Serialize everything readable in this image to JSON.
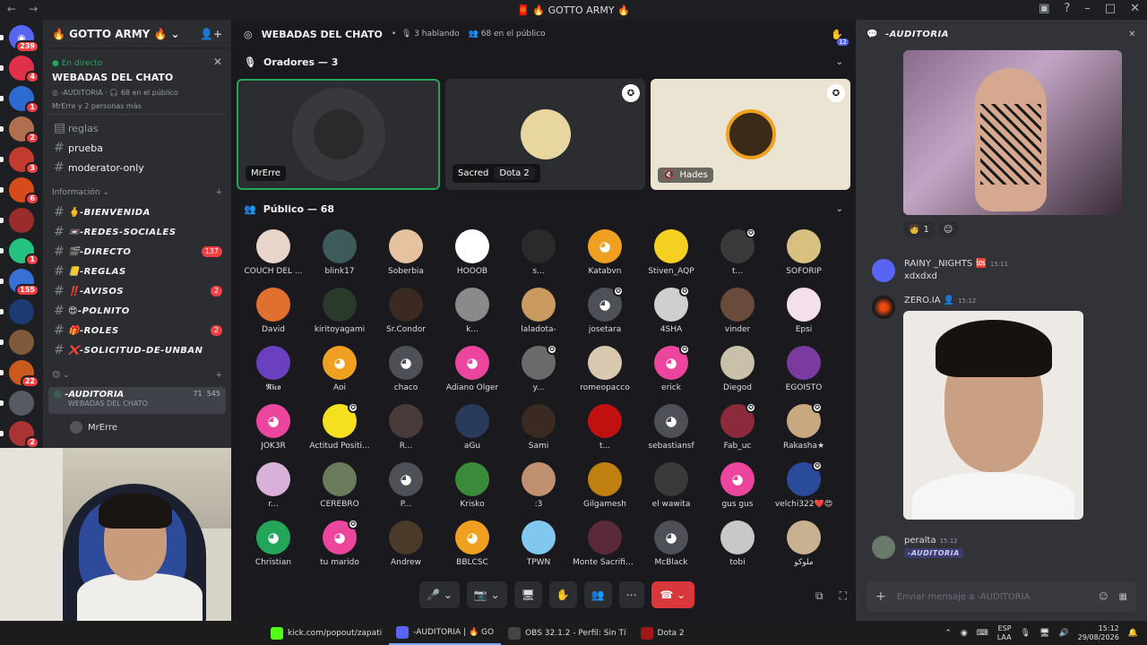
{
  "window": {
    "title": "🧧 🔥 GOTTO ARMY 🔥"
  },
  "servers": [
    {
      "name": "home",
      "color": "#5865f2",
      "badge": "239"
    },
    {
      "name": "s1",
      "color": "#e0304a",
      "badge": "4"
    },
    {
      "name": "s2",
      "color": "#2e6bd1",
      "badge": "1"
    },
    {
      "name": "s3",
      "color": "#b07050",
      "badge": "2"
    },
    {
      "name": "s4",
      "color": "#c23b2e",
      "badge": "3"
    },
    {
      "name": "s5",
      "color": "#d64b1a",
      "badge": "6"
    },
    {
      "name": "s6",
      "color": "#9a2c2c",
      "badge": ""
    },
    {
      "name": "s7",
      "color": "#26c281",
      "badge": "1"
    },
    {
      "name": "s8",
      "color": "#3b6fd8",
      "badge": "155"
    },
    {
      "name": "s9",
      "color": "#1d3b74",
      "badge": ""
    },
    {
      "name": "s10",
      "color": "#7e5a3a",
      "badge": ""
    },
    {
      "name": "s11",
      "color": "#c85a1e",
      "badge": "22"
    },
    {
      "name": "s12",
      "color": "#555a63",
      "badge": ""
    },
    {
      "name": "s13",
      "color": "#a33",
      "badge": "2"
    },
    {
      "name": "s14",
      "color": "#7a3355",
      "badge": ""
    }
  ],
  "guild": {
    "name": "🔥 GOTTO ARMY 🔥"
  },
  "live": {
    "status": "En directo",
    "title": "WEBADAS DEL CHATO",
    "host": "-AUDITORIA",
    "audience": "68 en el público",
    "others": "MrErre y 2 personas más"
  },
  "channels_top": [
    {
      "name": "reglas",
      "bold": false
    },
    {
      "name": "prueba",
      "bold": true
    },
    {
      "name": "moderator-only",
      "bold": true
    }
  ],
  "category_info": "Información",
  "channels_info": [
    {
      "name": "🫰-BIENVENIDA",
      "badge": ""
    },
    {
      "name": "📼-REDES-SOCIALES",
      "badge": ""
    },
    {
      "name": "🎬-DIRECTO",
      "badge": "137"
    },
    {
      "name": "📒-REGLAS",
      "badge": ""
    },
    {
      "name": "‼️-AVISOS",
      "badge": "2"
    },
    {
      "name": "😍-POLNITO",
      "badge": ""
    },
    {
      "name": "🎁-ROLES",
      "badge": "2"
    },
    {
      "name": "❌-SOLICITUD-DE-UNBAN",
      "badge": ""
    }
  ],
  "category_2": "😊",
  "voice_selected": {
    "name": "-AUDITORIA",
    "sub": "WEBADAS DEL CHATO",
    "count_a": "71",
    "count_b": "545",
    "user": "MrErre"
  },
  "stage": {
    "title": "WEBADAS DEL CHATO",
    "speaking": "3 hablando",
    "audience": "68 en el público",
    "hand_badge": "12",
    "speakers_label": "Oradores — 3",
    "audience_label": "Público — 68",
    "speakers": [
      {
        "name": "MrErre",
        "activity": "",
        "color": "#2a2a2a",
        "speaking": true,
        "mod": false,
        "light": false
      },
      {
        "name": "Sacred",
        "activity": "Dota 2",
        "color": "#e8d6a0",
        "speaking": false,
        "mod": true,
        "light": false
      },
      {
        "name": "Hades",
        "activity": "",
        "color": "#3a2a18",
        "speaking": false,
        "mod": true,
        "light": true
      }
    ],
    "audience_members": [
      {
        "name": "COUCH DEL ...",
        "color": "#e6d5c8",
        "mod": false,
        "disc": false
      },
      {
        "name": "blink17",
        "color": "#3d5b5a",
        "mod": false,
        "disc": false
      },
      {
        "name": "Soberbia",
        "color": "#e6c2a0",
        "mod": false,
        "disc": false
      },
      {
        "name": "HOOOB",
        "color": "#ffffff",
        "mod": false,
        "disc": false
      },
      {
        "name": "s...",
        "color": "#2a2a2a",
        "mod": false,
        "disc": false
      },
      {
        "name": "Katabvn",
        "color": "#f0a020",
        "mod": false,
        "disc": true
      },
      {
        "name": "Stiven_AQP",
        "color": "#f5d020",
        "mod": false,
        "disc": false
      },
      {
        "name": "t...",
        "color": "#3a3a3a",
        "mod": true,
        "disc": false
      },
      {
        "name": "SOFORIP",
        "color": "#d8c080",
        "mod": false,
        "disc": false
      },
      {
        "name": "David",
        "color": "#e07030",
        "mod": false,
        "disc": false
      },
      {
        "name": "kiritoyagami",
        "color": "#2a3a2a",
        "mod": false,
        "disc": false
      },
      {
        "name": "Sr.Condor",
        "color": "#3a2a22",
        "mod": false,
        "disc": false
      },
      {
        "name": "k...",
        "color": "#8a8a8a",
        "mod": false,
        "disc": false
      },
      {
        "name": "laladota-",
        "color": "#c89a60",
        "mod": false,
        "disc": false
      },
      {
        "name": "josetara",
        "color": "#4e5058",
        "mod": true,
        "disc": true
      },
      {
        "name": "4SHA",
        "color": "#cfcfcf",
        "mod": true,
        "disc": false
      },
      {
        "name": "vinder",
        "color": "#6a4a3a",
        "mod": false,
        "disc": false
      },
      {
        "name": "Epsi",
        "color": "#f4e0ec",
        "mod": false,
        "disc": false
      },
      {
        "name": "𝕽𝖎𝖈𝖔",
        "color": "#6a40c0",
        "mod": false,
        "disc": false
      },
      {
        "name": "Aoi",
        "color": "#f0a020",
        "mod": false,
        "disc": true
      },
      {
        "name": "chaco",
        "color": "#4e5058",
        "mod": false,
        "disc": true
      },
      {
        "name": "Adiano Olger",
        "color": "#eb459e",
        "mod": false,
        "disc": true
      },
      {
        "name": "y...",
        "color": "#6a6a6a",
        "mod": true,
        "disc": false
      },
      {
        "name": "romeopacco",
        "color": "#d8c8b0",
        "mod": false,
        "disc": false
      },
      {
        "name": "erick",
        "color": "#eb459e",
        "mod": true,
        "disc": true
      },
      {
        "name": "Diegod",
        "color": "#c8c0a8",
        "mod": false,
        "disc": false
      },
      {
        "name": "EGOISTO",
        "color": "#7a3aa0",
        "mod": false,
        "disc": false
      },
      {
        "name": "JOK3R",
        "color": "#eb459e",
        "mod": false,
        "disc": true
      },
      {
        "name": "Actitud Positi...",
        "color": "#f5e020",
        "mod": true,
        "disc": false
      },
      {
        "name": "R...",
        "color": "#4a3a3a",
        "mod": false,
        "disc": false
      },
      {
        "name": "aGu",
        "color": "#2a3a5a",
        "mod": false,
        "disc": false
      },
      {
        "name": "Sami",
        "color": "#3a2a22",
        "mod": false,
        "disc": false
      },
      {
        "name": "t...",
        "color": "#c01010",
        "mod": false,
        "disc": false
      },
      {
        "name": "sebastiansf",
        "color": "#4e5058",
        "mod": false,
        "disc": true
      },
      {
        "name": "Fab_uc",
        "color": "#8a2a3a",
        "mod": true,
        "disc": false
      },
      {
        "name": "Rakasha★",
        "color": "#c8a880",
        "mod": true,
        "disc": false
      },
      {
        "name": "r...",
        "color": "#d8b0d8",
        "mod": false,
        "disc": false
      },
      {
        "name": "CEREBRO",
        "color": "#6a7a5a",
        "mod": false,
        "disc": false
      },
      {
        "name": "P...",
        "color": "#4e5058",
        "mod": false,
        "disc": true
      },
      {
        "name": "Krisko",
        "color": "#3a8a3a",
        "mod": false,
        "disc": false
      },
      {
        "name": ":3",
        "color": "#c09070",
        "mod": false,
        "disc": false
      },
      {
        "name": "Gilgamesh",
        "color": "#c08010",
        "mod": false,
        "disc": false
      },
      {
        "name": "el wawita",
        "color": "#3a3a3a",
        "mod": false,
        "disc": false
      },
      {
        "name": "gus gus",
        "color": "#eb459e",
        "mod": false,
        "disc": true
      },
      {
        "name": "velchi322❤️😍",
        "color": "#2a4a9a",
        "mod": true,
        "disc": false
      },
      {
        "name": "Christian",
        "color": "#23a55a",
        "mod": false,
        "disc": true
      },
      {
        "name": "tu marido",
        "color": "#eb459e",
        "mod": true,
        "disc": true
      },
      {
        "name": "Andrew",
        "color": "#4a3a2a",
        "mod": false,
        "disc": false
      },
      {
        "name": "BBLCSC",
        "color": "#f0a020",
        "mod": false,
        "disc": true
      },
      {
        "name": "TPWN",
        "color": "#80c8f0",
        "mod": false,
        "disc": false
      },
      {
        "name": "Monte Sacrific...",
        "color": "#5a2a3a",
        "mod": false,
        "disc": false
      },
      {
        "name": "McBlack",
        "color": "#4e5058",
        "mod": false,
        "disc": true
      },
      {
        "name": "tobi",
        "color": "#c8c8c8",
        "mod": false,
        "disc": false
      },
      {
        "name": "ملوكو",
        "color": "#c8b090",
        "mod": false,
        "disc": false
      }
    ]
  },
  "controls": [
    "🎤",
    "⌄",
    "📷",
    "⌄",
    "🖥",
    "✋",
    "👥",
    "⋯"
  ],
  "chat": {
    "channel": "-AUDITORIA",
    "reaction_count": "1",
    "msg1": {
      "author": "RAINY _NIGHTS",
      "time": "15:11",
      "text": "xdxdxd"
    },
    "msg2": {
      "author": "ZERO.IA",
      "time": "15:12"
    },
    "msg3": {
      "author": "peralta",
      "time": "15:12",
      "tag": "-AUDITORIA"
    },
    "placeholder": "Enviar mensaje a -AUDITORIA"
  },
  "taskbar": [
    {
      "label": "kick.com/popout/zapati",
      "color": "#53fc18",
      "active": false
    },
    {
      "label": "-AUDITORIA | 🔥 GO",
      "color": "#5865f2",
      "active": true
    },
    {
      "label": "OBS 32.1.2 - Perfil: Sin Tí",
      "color": "#444",
      "active": false
    },
    {
      "label": "Dota 2",
      "color": "#a01818",
      "active": false
    }
  ],
  "tray": {
    "lang": "ESP",
    "lang2": "LAA",
    "time": "15:12",
    "date": "29/08/2026"
  }
}
